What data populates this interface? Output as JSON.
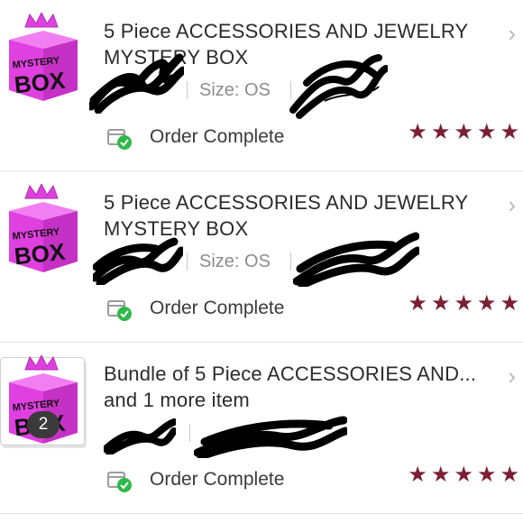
{
  "colors": {
    "star": "#7b1f35",
    "box_pink": "#e040e0",
    "crown": "#e040e0",
    "check_green": "#2eb84a"
  },
  "orders": [
    {
      "thumbnail_label_top": "MYSTERY",
      "thumbnail_label_bottom": "BOX",
      "title": "5 Piece ACCESSORIES AND JEWELRY MYSTERY BOX",
      "size": "Size: OS",
      "status": "Order Complete",
      "rating": 5,
      "quantity": null
    },
    {
      "thumbnail_label_top": "MYSTERY",
      "thumbnail_label_bottom": "BOX",
      "title": "5 Piece ACCESSORIES AND JEWELRY MYSTERY BOX",
      "size": "Size: OS",
      "status": "Order Complete",
      "rating": 5,
      "quantity": null
    },
    {
      "thumbnail_label_top": "MYSTERY",
      "thumbnail_label_bottom": "BOX",
      "title": "Bundle of 5 Piece ACCESSORIES AND... and 1 more item",
      "size": "",
      "status": "Order Complete",
      "rating": 5,
      "quantity": "2"
    }
  ],
  "icons": {
    "chevron": "chevron-right-icon",
    "status": "package-check-icon",
    "star": "star-icon"
  }
}
